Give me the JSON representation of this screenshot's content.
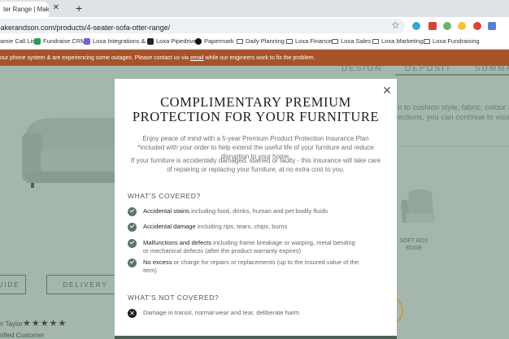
{
  "browser": {
    "tab_title": "ter Range | Make",
    "url": "makerandson.com/products/4-seater-sofa-otter-range/",
    "bookmarks": [
      "amie Call List",
      "Fundraise CRM",
      "Loxa Integrations &...",
      "Loxa Pipedrive",
      "Papermark",
      "Daily Planning",
      "Loxa Finance",
      "Loxa Sales",
      "Loxa Marketing",
      "Loxa Fundraising"
    ]
  },
  "banner": {
    "text_before": "our phone system & are experiencing some outages. Please contact us via ",
    "link": "email",
    "text_after": " while our engineers work to fix the problem."
  },
  "background": {
    "tabs": [
      "DESIGN",
      "DEPOSIT",
      "SUMMA"
    ],
    "text_lines": [
      "n to cushion style, fabric, colour an",
      "ections, you can continue to visual"
    ],
    "chair_label": "SOFT BOX EDGE",
    "buttons": [
      "UIDE",
      "DELIVERY"
    ],
    "reviewer": "n Taylor",
    "stars": "★★★★★",
    "verified": "rified Customer"
  },
  "modal": {
    "title_line1": "COMPLIMENTARY PREMIUM",
    "title_line2": "PROTECTION FOR YOUR FURNITURE",
    "intro": "Enjoy peace of mind with a 5-year Premium Product Protection Insurance Plan *included with your order to help extend the useful life of your furniture and reduce disruption to your home.",
    "detail": "If your furniture is accidentally damaged, stained or faulty - this insurance will take care of repairing or replacing your furniture, at no extra cost to you.",
    "covered_heading": "WHAT'S COVERED?",
    "covered": [
      {
        "bold": "Accidental stains",
        "rest": " including food, drinks, human and pet bodily fluids"
      },
      {
        "bold": "Accidental damage",
        "rest": " including rips, tears, chips, burns"
      },
      {
        "bold": "Malfunctions and defects",
        "rest": " including frame breakage or warping, metal bending or mechanical defects (after the product warranty expires)"
      },
      {
        "bold": "No excess",
        "rest": " or charge for repairs or replacements (up to the insured value of the item)"
      }
    ],
    "not_covered_heading": "WHAT'S NOT COVERED?",
    "not_covered": [
      "Damage in transit, normal wear and tear, deliberate harm"
    ]
  },
  "colors": {
    "accent": "#a7532a",
    "check": "#607369",
    "bg": "#b7c7bf"
  }
}
